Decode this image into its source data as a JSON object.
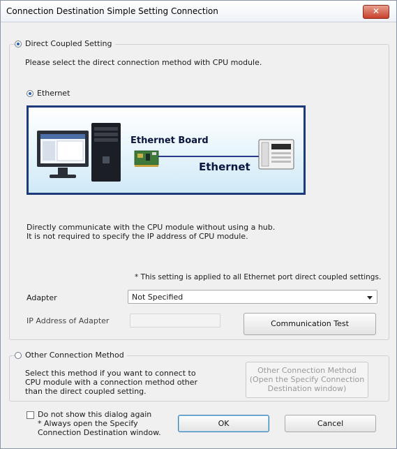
{
  "window": {
    "title": "Connection Destination Simple Setting Connection",
    "close_label": "✕"
  },
  "direct": {
    "label": "Direct Coupled Setting",
    "instruction": "Please select the direct connection method with CPU module.",
    "ethernet_label": "Ethernet",
    "diagram": {
      "board_label": "Ethernet Board",
      "cable_label": "Ethernet"
    },
    "description": "Directly communicate with the CPU module without using a hub.\nIt is not required to specify the IP address of CPU module.",
    "note": "* This setting is applied to all Ethernet port direct coupled settings.",
    "adapter_label": "Adapter",
    "adapter_value": "Not Specified",
    "ip_label": "IP Address of Adapter",
    "ip_value": "",
    "test_button": "Communication Test"
  },
  "other": {
    "label": "Other Connection Method",
    "description": "Select this method if you want to connect to\nCPU module with a connection method other\nthan the direct coupled setting.",
    "button": "Other Connection Method\n(Open the Specify Connection\nDestination window)"
  },
  "footer": {
    "checkbox_label": "Do not show this dialog again\n* Always open the Specify\nConnection Destination window.",
    "ok": "OK",
    "cancel": "Cancel"
  }
}
